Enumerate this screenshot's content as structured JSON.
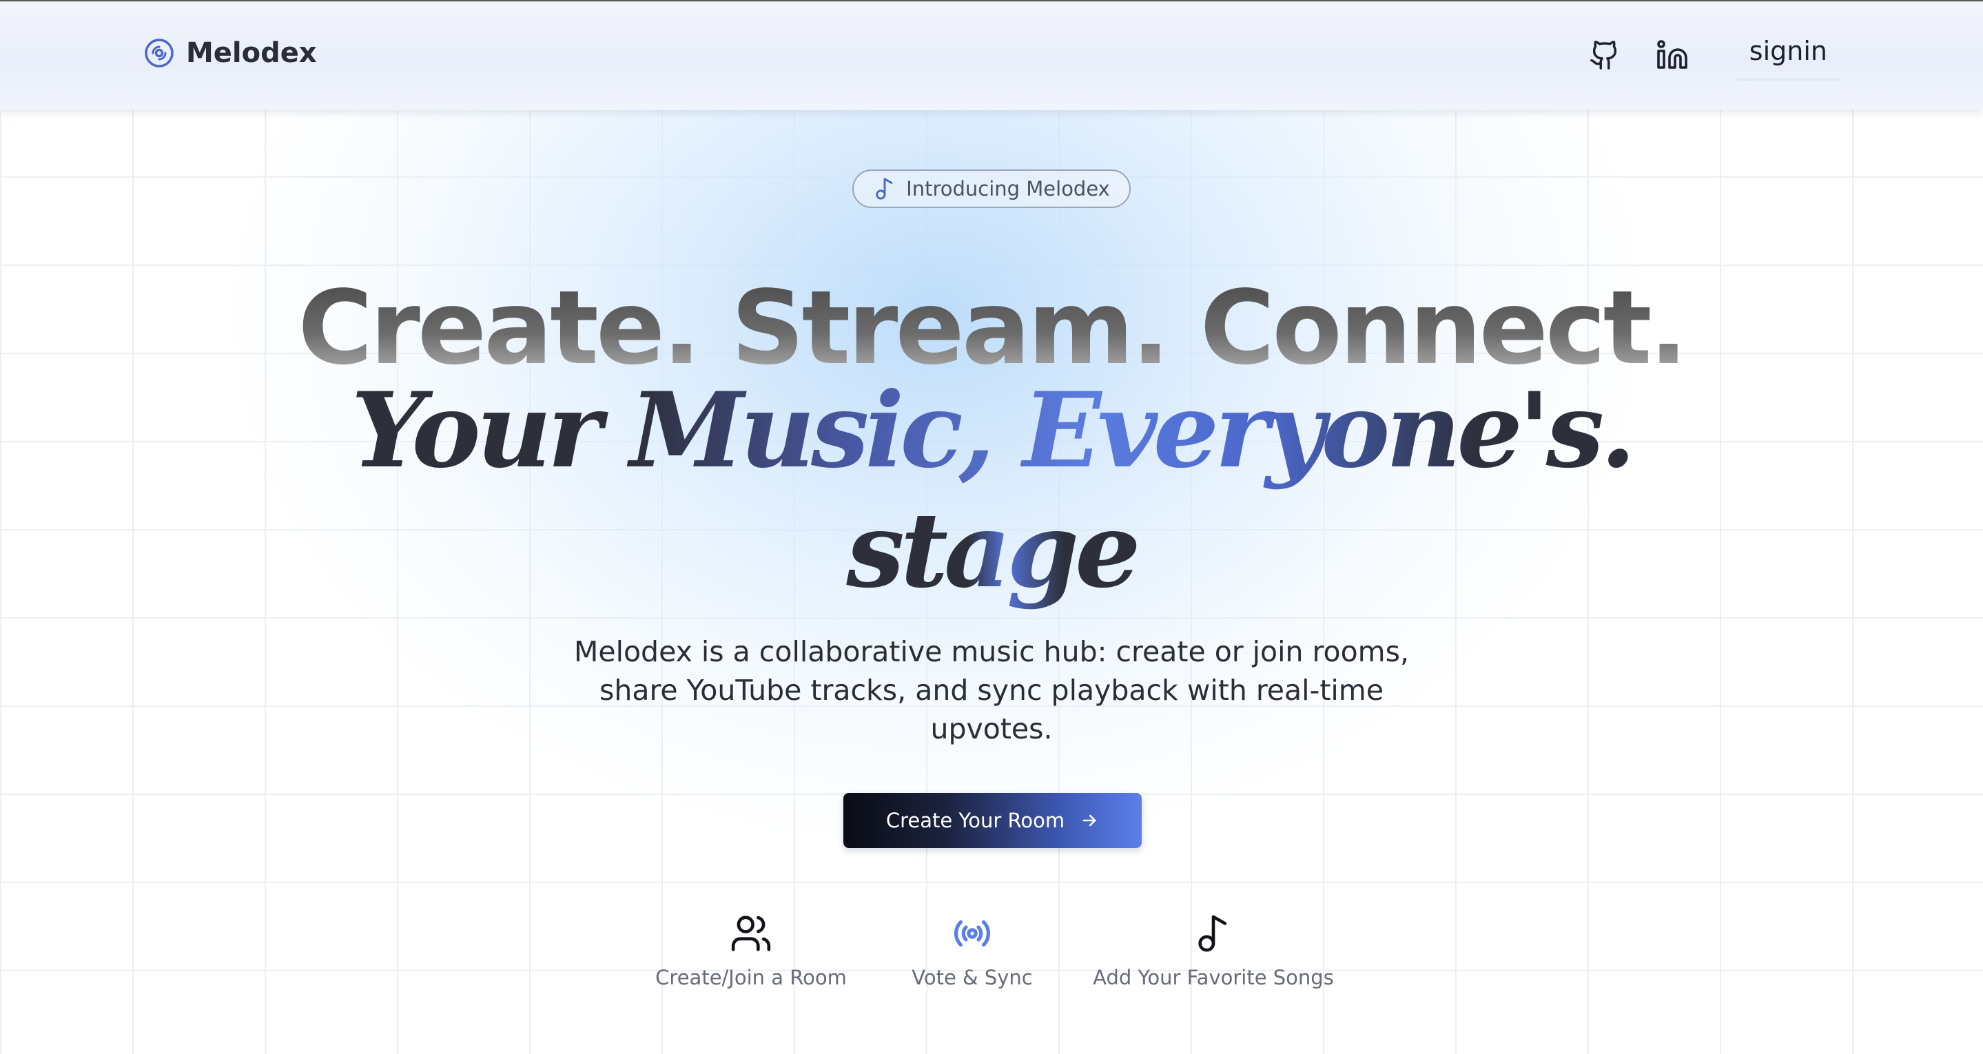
{
  "brand": {
    "name": "Melodex",
    "accent": "#4a66c8"
  },
  "nav": {
    "github_icon": "github-icon",
    "linkedin_icon": "linkedin-icon",
    "signin_label": "signin"
  },
  "hero": {
    "badge_label": "Introducing Melodex",
    "headline": "Create. Stream. Connect.",
    "tagline_line1": "Your Music, Everyone's.",
    "tagline_line2": "stage",
    "description": "Melodex is a collaborative music hub: create or join rooms, share YouTube tracks, and sync playback with real-time upvotes.",
    "cta_label": "Create Your Room"
  },
  "features": [
    {
      "icon": "users-icon",
      "label": "Create/Join a Room"
    },
    {
      "icon": "broadcast-icon",
      "label": "Vote & Sync"
    },
    {
      "icon": "music-note-icon",
      "label": "Add Your Favorite Songs"
    }
  ],
  "colors": {
    "cta_start": "#0a0c14",
    "cta_end": "#5b7fe8",
    "broadcast_icon": "#5b7fe8"
  }
}
